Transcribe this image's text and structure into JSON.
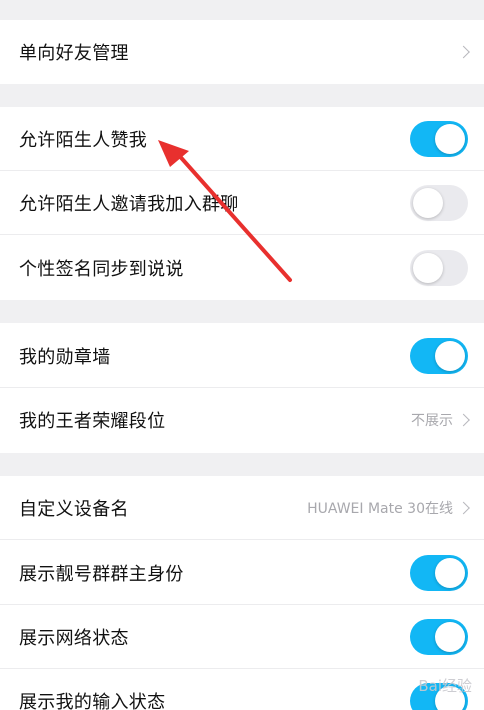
{
  "rows": {
    "one_way_friends": {
      "label": "单向好友管理"
    },
    "allow_stranger_like": {
      "label": "允许陌生人赞我",
      "on": true
    },
    "allow_stranger_group_invite": {
      "label": "允许陌生人邀请我加入群聊",
      "on": false
    },
    "sync_signature": {
      "label": "个性签名同步到说说",
      "on": false
    },
    "badge_wall": {
      "label": "我的勋章墙",
      "on": true
    },
    "honor_of_kings_rank": {
      "label": "我的王者荣耀段位",
      "value": "不展示"
    },
    "custom_device_name": {
      "label": "自定义设备名",
      "value": "HUAWEI Mate 30在线"
    },
    "show_pretty_number_owner": {
      "label": "展示靓号群群主身份",
      "on": true
    },
    "show_network_status": {
      "label": "展示网络状态",
      "on": true
    },
    "show_input_status": {
      "label": "展示我的输入状态",
      "on": true
    }
  },
  "colors": {
    "toggle_on": "#12b7f5",
    "toggle_off": "#eaeaee",
    "annotation_arrow": "#e8302e"
  },
  "watermark": "Bai经验"
}
